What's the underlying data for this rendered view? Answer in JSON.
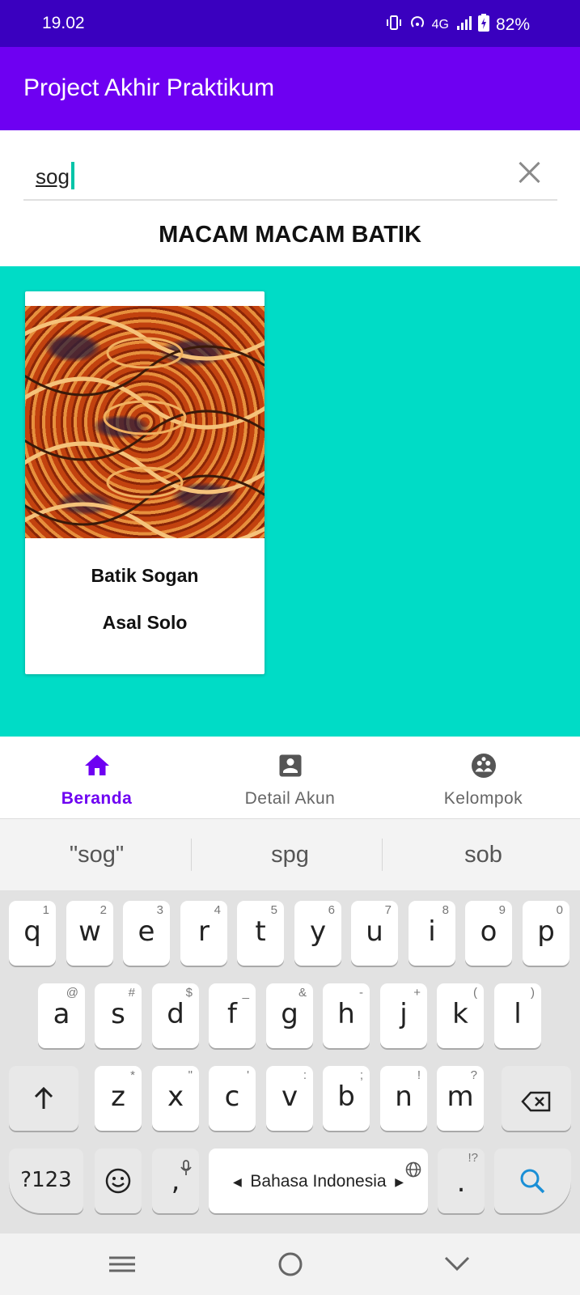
{
  "status_bar": {
    "time": "19.02",
    "network": "4G",
    "battery": "82%",
    "icons": [
      "vibrate-icon",
      "hotspot-icon",
      "signal-icon",
      "battery-icon"
    ]
  },
  "app_bar": {
    "title": "Project Akhir Praktikum"
  },
  "search": {
    "value": "sog"
  },
  "section": {
    "title": "MACAM MACAM BATIK"
  },
  "cards": [
    {
      "name": "Batik Sogan",
      "origin": "Asal Solo",
      "image": "batik-sogan-pattern"
    }
  ],
  "bottom_nav": {
    "items": [
      {
        "label": "Beranda",
        "icon": "home-icon",
        "active": true
      },
      {
        "label": "Detail Akun",
        "icon": "account-box-icon",
        "active": false
      },
      {
        "label": "Kelompok",
        "icon": "group-icon",
        "active": false
      }
    ]
  },
  "suggestions": [
    "\"sog\"",
    "spg",
    "sob"
  ],
  "keyboard": {
    "row1": [
      {
        "k": "q",
        "h": "1"
      },
      {
        "k": "w",
        "h": "2"
      },
      {
        "k": "e",
        "h": "3"
      },
      {
        "k": "r",
        "h": "4"
      },
      {
        "k": "t",
        "h": "5"
      },
      {
        "k": "y",
        "h": "6"
      },
      {
        "k": "u",
        "h": "7"
      },
      {
        "k": "i",
        "h": "8"
      },
      {
        "k": "o",
        "h": "9"
      },
      {
        "k": "p",
        "h": "0"
      }
    ],
    "row2": [
      {
        "k": "a",
        "h": "@"
      },
      {
        "k": "s",
        "h": "#"
      },
      {
        "k": "d",
        "h": "$"
      },
      {
        "k": "f",
        "h": "_"
      },
      {
        "k": "g",
        "h": "&"
      },
      {
        "k": "h",
        "h": "-"
      },
      {
        "k": "j",
        "h": "+"
      },
      {
        "k": "k",
        "h": "("
      },
      {
        "k": "l",
        "h": ")"
      }
    ],
    "row3": [
      {
        "k": "z",
        "h": "*"
      },
      {
        "k": "x",
        "h": "\""
      },
      {
        "k": "c",
        "h": "'"
      },
      {
        "k": "v",
        "h": ":"
      },
      {
        "k": "b",
        "h": ";"
      },
      {
        "k": "n",
        "h": "!"
      },
      {
        "k": "m",
        "h": "?"
      }
    ],
    "symbols_label": "?123",
    "comma": ",",
    "space_label": "Bahasa Indonesia",
    "period": ".",
    "period_hint": "!?"
  },
  "colors": {
    "status_bar": "#3a00bf",
    "app_bar": "#6e00f2",
    "content_bg": "#00dcc6",
    "accent": "#6e00f2",
    "cursor": "#00c4a8"
  }
}
